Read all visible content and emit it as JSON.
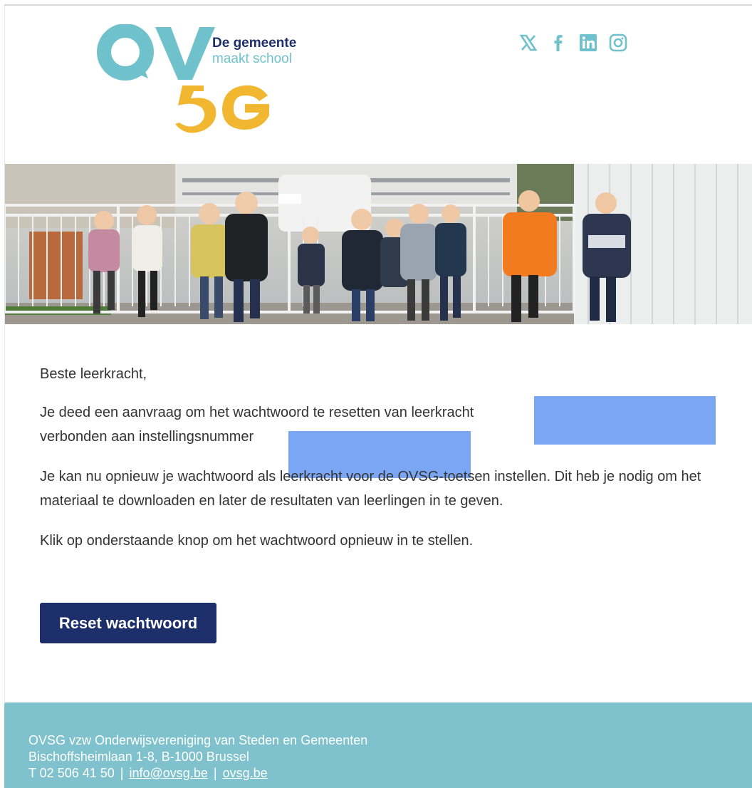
{
  "header": {
    "tagline_line1": "De gemeente",
    "tagline_line2": "maakt school",
    "logo_letters_top": "OV",
    "logo_letters_bottom": "SG",
    "social": [
      {
        "name": "x-icon"
      },
      {
        "name": "facebook-icon"
      },
      {
        "name": "linkedin-icon"
      },
      {
        "name": "instagram-icon"
      }
    ]
  },
  "body": {
    "greeting": "Beste leerkracht,",
    "para1_line1": "Je deed een aanvraag om het wachtwoord te resetten van leerkracht",
    "para1_line2": "verbonden aan instellingsnummer",
    "para2": "Je kan nu opnieuw je wachtwoord als leerkracht voor de OVSG-toetsen instellen. Dit heb je nodig om het materiaal te downloaden en later de resultaten van leerlingen in te geven.",
    "para3": "Klik op onderstaande knop om het wachtwoord opnieuw in te stellen.",
    "button_label": "Reset wachtwoord"
  },
  "footer": {
    "line1": "OVSG vzw Onderwijsvereniging van Steden en Gemeenten",
    "line2": "Bischoffsheimlaan 1-8, B-1000 Brussel",
    "phone": "T 02 506 41 50",
    "separator": "|",
    "email": "info@ovsg.be",
    "website": "ovsg.be"
  },
  "colors": {
    "brand_navy": "#1c2f6b",
    "brand_teal": "#6fc2cc",
    "brand_yellow": "#f2b731",
    "footer_bg": "#7fc2cd",
    "redaction": "#7ba6f4"
  }
}
